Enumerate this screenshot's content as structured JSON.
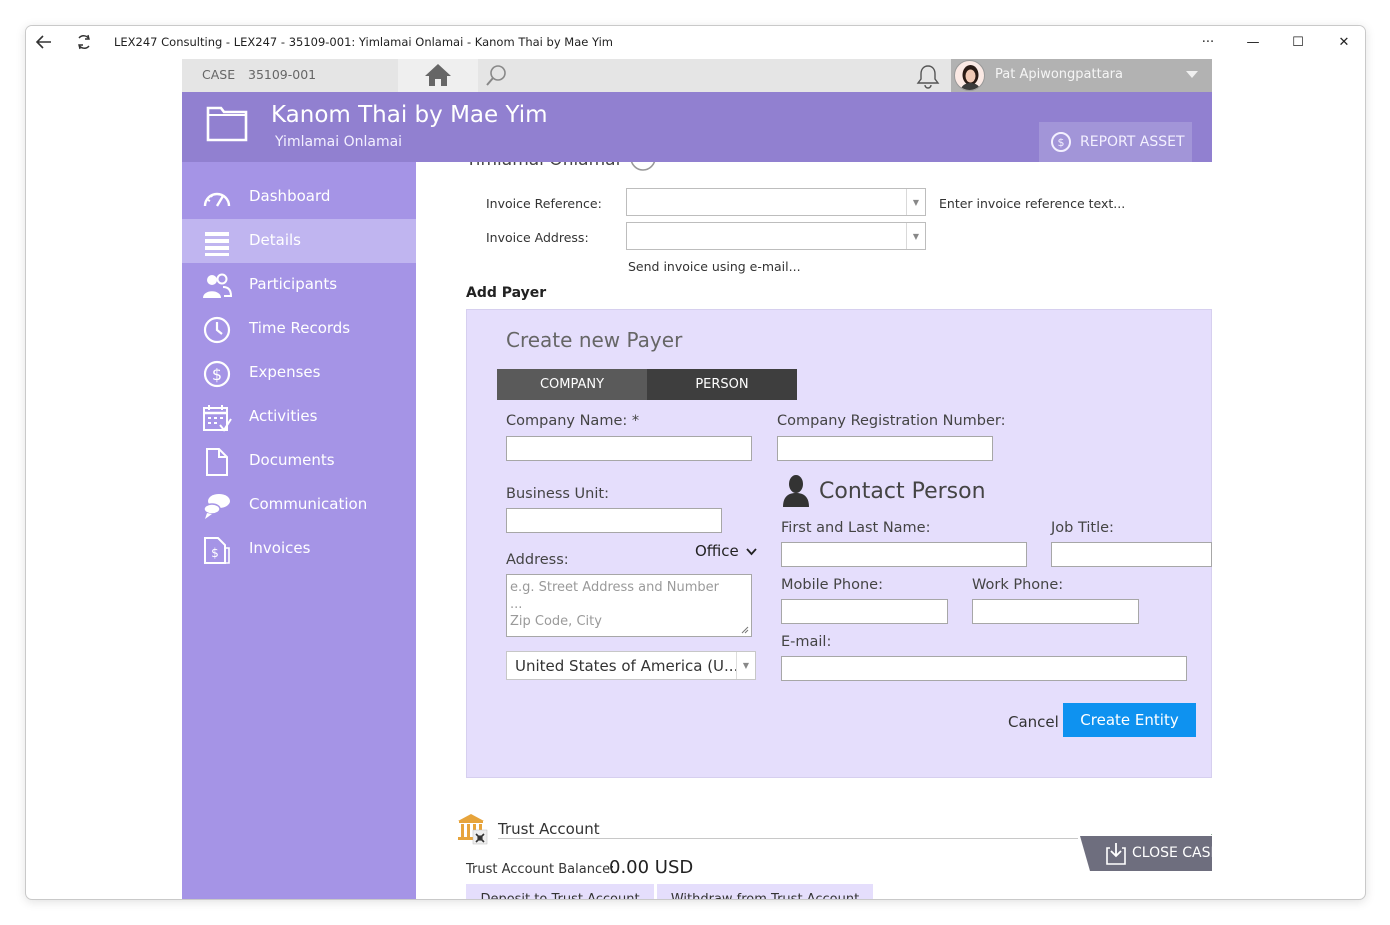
{
  "window": {
    "title": "LEX247 Consulting - LEX247 - 35109-001: Yimlamai Onlamai - Kanom Thai by Mae Yim",
    "controls": {
      "more": "···",
      "minimize": "—",
      "maximize": "☐",
      "close": "✕"
    }
  },
  "topbar": {
    "case_label": "CASE",
    "case_number": "35109-001",
    "user_name": "Pat Apiwongpattara"
  },
  "header": {
    "title": "Kanom Thai by Mae Yim",
    "subtitle": "Yimlamai Onlamai",
    "report_asset_label": "REPORT ASSET"
  },
  "sidebar": {
    "items": [
      {
        "label": "Dashboard",
        "icon": "dashboard-icon"
      },
      {
        "label": "Details",
        "icon": "details-icon",
        "active": true
      },
      {
        "label": "Participants",
        "icon": "participants-icon"
      },
      {
        "label": "Time Records",
        "icon": "clock-icon"
      },
      {
        "label": "Expenses",
        "icon": "dollar-icon"
      },
      {
        "label": "Activities",
        "icon": "calendar-icon"
      },
      {
        "label": "Documents",
        "icon": "document-icon"
      },
      {
        "label": "Communication",
        "icon": "chat-icon"
      },
      {
        "label": "Invoices",
        "icon": "invoice-icon"
      }
    ]
  },
  "invoice": {
    "partial_heading": "Yimlamai Onlamai",
    "reference_label": "Invoice Reference:",
    "reference_hint": "Enter invoice reference text...",
    "address_label": "Invoice Address:",
    "email_link": "Send invoice using e-mail..."
  },
  "add_payer": {
    "heading": "Add Payer",
    "panel_title": "Create new Payer",
    "tabs": {
      "company": "COMPANY",
      "person": "PERSON"
    },
    "company_name_label": "Company Name: *",
    "company_reg_label": "Company Registration Number:",
    "business_unit_label": "Business Unit:",
    "address_label": "Address:",
    "address_type": "Office",
    "address_placeholder": "e.g. Street Address and Number\n...\nZip Code, City",
    "country": "United States of America (U...",
    "contact": {
      "heading": "Contact Person",
      "name_label": "First and Last Name:",
      "job_label": "Job Title:",
      "mobile_label": "Mobile Phone:",
      "work_label": "Work Phone:",
      "email_label": "E-mail:"
    },
    "cancel_label": "Cancel",
    "create_label": "Create Entity"
  },
  "trust": {
    "title": "Trust Account",
    "balance_label": "Trust Account Balance:",
    "balance": "0.00 USD",
    "deposit_label": "Deposit to Trust Account",
    "withdraw_label": "Withdraw from Trust Account"
  },
  "close_case_label": "CLOSE CASE",
  "colors": {
    "header": "#9180d0",
    "sidebar": "#a594e6",
    "sidebar_active": "#c0b5f0",
    "panel": "#e5defc",
    "primary_button": "#0e92f0"
  }
}
